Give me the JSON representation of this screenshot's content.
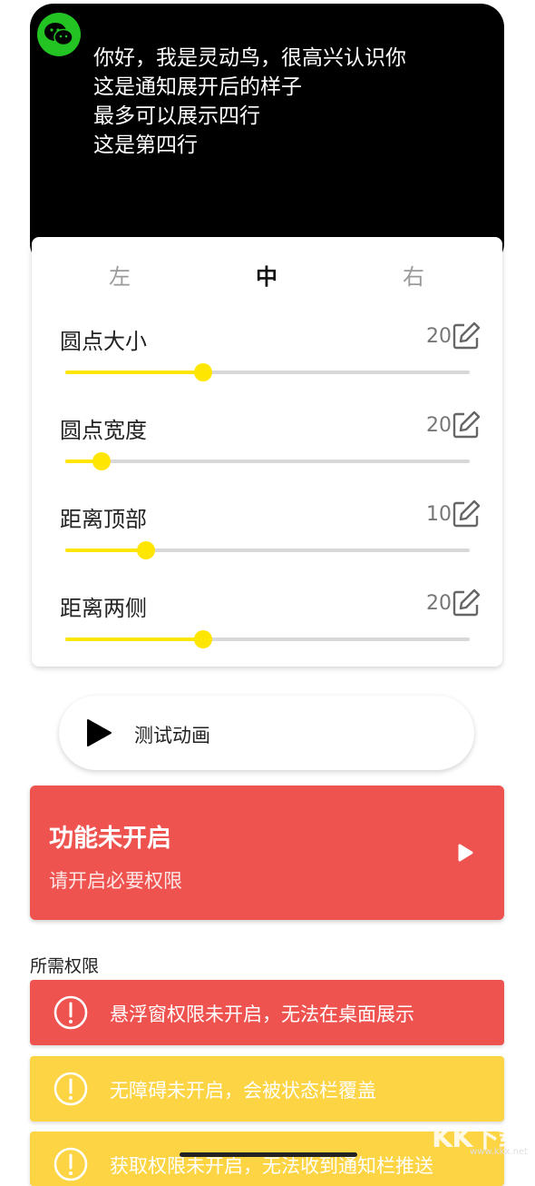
{
  "notification": {
    "app_icon": "wechat-icon",
    "lines": [
      "你好，我是灵动鸟，很高兴认识你",
      "这是通知展开后的样子",
      "最多可以展示四行",
      "这是第四行"
    ]
  },
  "position_tabs": {
    "left": "左",
    "middle": "中",
    "right": "右",
    "selected": "中"
  },
  "settings": {
    "dot_size": {
      "label": "圆点大小",
      "value": "20",
      "level": 0.34
    },
    "dot_width": {
      "label": "圆点宽度",
      "value": "20",
      "level": 0.09
    },
    "top_distance": {
      "label": "距离顶部",
      "value": "10",
      "level": 0.2
    },
    "side_distance": {
      "label": "距离两侧",
      "value": "20",
      "level": 0.34
    }
  },
  "test_button": {
    "label": "测试动画",
    "icon": "play-icon"
  },
  "status_card": {
    "title": "功能未开启",
    "subtitle": "请开启必要权限",
    "color": "#ef5350"
  },
  "permissions": {
    "heading": "所需权限",
    "items": [
      {
        "text": "悬浮窗权限未开启，无法在桌面展示",
        "color": "#ef5350"
      },
      {
        "text": "无障碍未开启，会被状态栏覆盖",
        "color": "#fdd444"
      },
      {
        "text": "获取权限未开启，无法收到通知栏推送",
        "color": "#fdd444"
      }
    ]
  },
  "colors": {
    "slider_accent": "#ffe600",
    "wechat_green": "#22c322"
  },
  "watermark": {
    "brand": "KK下载",
    "url": "www.kkx.net"
  }
}
